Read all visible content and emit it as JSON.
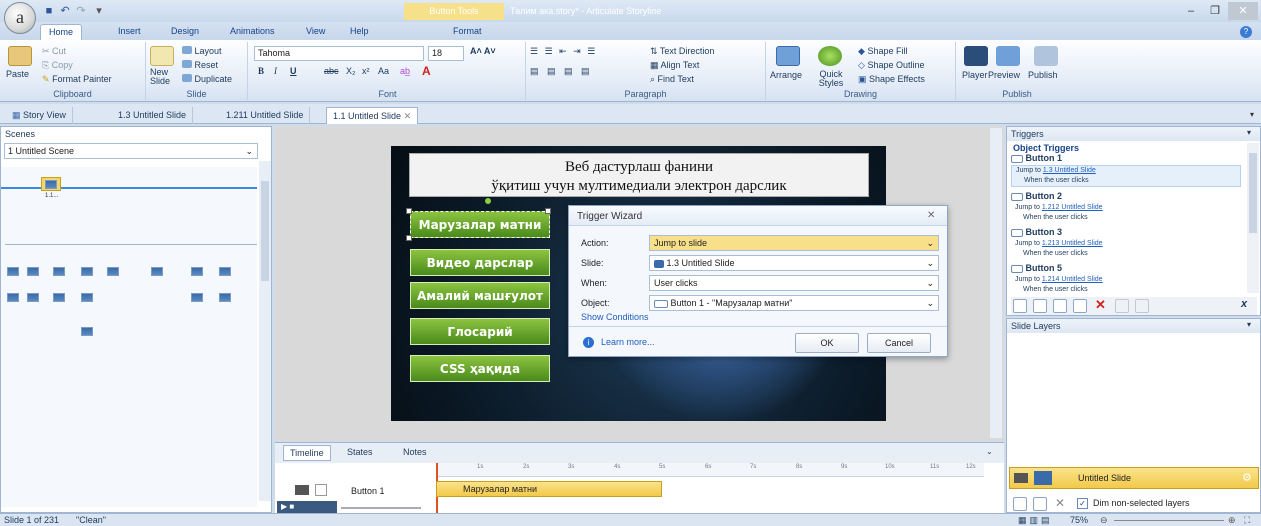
{
  "window": {
    "context_tab": "Button Tools",
    "title": "Талим ака.story* - Articulate Storyline",
    "app_letter": "a",
    "minimize": "–",
    "restore": "❐",
    "close": "✕"
  },
  "tabs": [
    "Home",
    "Insert",
    "Design",
    "Animations",
    "View",
    "Help",
    "Format"
  ],
  "ribbon": {
    "clipboard": {
      "cut": "Cut",
      "copy": "Copy",
      "paste": "Paste",
      "format_painter": "Format Painter",
      "label": "Clipboard"
    },
    "slide": {
      "layout": "Layout",
      "reset": "Reset",
      "new_slide": "New Slide",
      "duplicate": "Duplicate",
      "label": "Slide"
    },
    "font": {
      "font_name": "Tahoma",
      "font_size": "18",
      "label": "Font",
      "bold": "B",
      "italic": "I",
      "underline": "U",
      "strike": "abc",
      "sub": "X₂",
      "sup": "x²",
      "case": "Aa"
    },
    "paragraph": {
      "text_direction": "Text Direction",
      "align_text": "Align Text",
      "find_text": "Find Text",
      "label": "Paragraph"
    },
    "drawing": {
      "arrange": "Arrange",
      "quick_styles": "Quick Styles",
      "shape_fill": "Shape Fill",
      "shape_outline": "Shape Outline",
      "shape_effects": "Shape Effects",
      "label": "Drawing"
    },
    "publish": {
      "player": "Player",
      "preview": "Preview",
      "publish": "Publish",
      "label": "Publish"
    }
  },
  "doc_tabs": [
    {
      "label": "Story View"
    },
    {
      "label": "1.3 Untitled Slide"
    },
    {
      "label": "1.211 Untitled Slide"
    },
    {
      "label": "1.1 Untitled Slide"
    }
  ],
  "scenes": {
    "header": "Scenes",
    "selected_scene": "1 Untitled Scene",
    "thumb_label": "1.1..."
  },
  "slide": {
    "title_line1": "Веб дастурлаш фанини",
    "title_line2": "ўқитиш учун мултимедиали электрон дарслик",
    "buttons": [
      "Марузалар матни",
      "Видео дарслар",
      "Амалий машғулот",
      "Глосарий",
      "CSS ҳақида"
    ]
  },
  "wizard": {
    "title": "Trigger Wizard",
    "action_label": "Action:",
    "action_value": "Jump to slide",
    "slide_label": "Slide:",
    "slide_value": "1.3 Untitled Slide",
    "when_label": "When:",
    "when_value": "User clicks",
    "object_label": "Object:",
    "object_value": "Button 1 - \"Марузалар матни\"",
    "show_conditions": "Show Conditions",
    "learn_more": "Learn more...",
    "ok": "OK",
    "cancel": "Cancel"
  },
  "timeline": {
    "tabs": [
      "Timeline",
      "States",
      "Notes"
    ],
    "ticks": [
      "1s",
      "2s",
      "3s",
      "4s",
      "5s",
      "6s",
      "7s",
      "8s",
      "9s",
      "10s",
      "11s",
      "12s"
    ],
    "row_name": "Button 1",
    "bar_label": "Марузалар матни"
  },
  "triggers": {
    "header": "Triggers",
    "group": "Object Triggers",
    "items": [
      {
        "name": "Button 1",
        "jump": "Jump to",
        "target": "1.3 Untitled Slide",
        "when": "When the user clicks"
      },
      {
        "name": "Button 2",
        "jump": "Jump to",
        "target": "1.212 Untitled Slide",
        "when": "When the user clicks"
      },
      {
        "name": "Button 3",
        "jump": "Jump to",
        "target": "1.213 Untitled Slide",
        "when": "When the user clicks"
      },
      {
        "name": "Button 5",
        "jump": "Jump to",
        "target": "1.214 Untitled Slide",
        "when": "When the user clicks"
      }
    ]
  },
  "layers": {
    "header": "Slide Layers",
    "base": "Untitled Slide",
    "dim": "Dim non-selected layers"
  },
  "status": {
    "slide": "Slide 1 of 231",
    "theme": "\"Clean\"",
    "zoom": "75%"
  }
}
